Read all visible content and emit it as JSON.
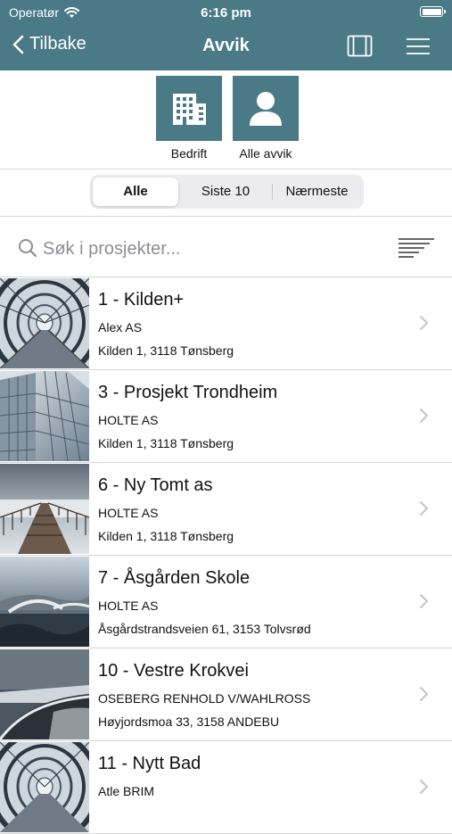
{
  "status_bar": {
    "carrier": "Operatør",
    "time": "6:16 pm"
  },
  "nav": {
    "back_label": "Tilbake",
    "title": "Avvik"
  },
  "modes": [
    {
      "label": "Bedrift",
      "icon": "building-icon"
    },
    {
      "label": "Alle avvik",
      "icon": "person-icon"
    }
  ],
  "segments": [
    "Alle",
    "Siste 10",
    "Nærmeste"
  ],
  "active_segment": "Alle",
  "search": {
    "placeholder": "Søk i prosjekter..."
  },
  "projects": [
    {
      "title": "1 - Kilden+",
      "company": "Alex AS",
      "address": "Kilden 1, 3118 Tønsberg",
      "image": "tunnel-walkway"
    },
    {
      "title": "3 - Prosjekt Trondheim",
      "company": "HOLTE AS",
      "address": "Kilden 1, 3118 Tønsberg",
      "image": "glass-building"
    },
    {
      "title": "6 - Ny Tomt as",
      "company": "HOLTE AS",
      "address": "Kilden 1, 3118 Tønsberg",
      "image": "pier"
    },
    {
      "title": "7 - Åsgården Skole",
      "company": "HOLTE AS",
      "address": "Åsgårdstrandsveien 61, 3153 Tolvsrød",
      "image": "coastal-bridge"
    },
    {
      "title": "10 - Vestre Krokvei",
      "company": "OSEBERG RENHOLD V/WAHLROSS",
      "address": "Høyjordsmoa 33, 3158 ANDEBU",
      "image": "sea-wall"
    },
    {
      "title": "11 - Nytt Bad",
      "company": "Atle BRIM",
      "address": "",
      "image": "tunnel-walkway"
    }
  ],
  "colors": {
    "brand": "#4a7a86",
    "separator": "#d6d6d6",
    "chevron": "#c7c7cc"
  }
}
